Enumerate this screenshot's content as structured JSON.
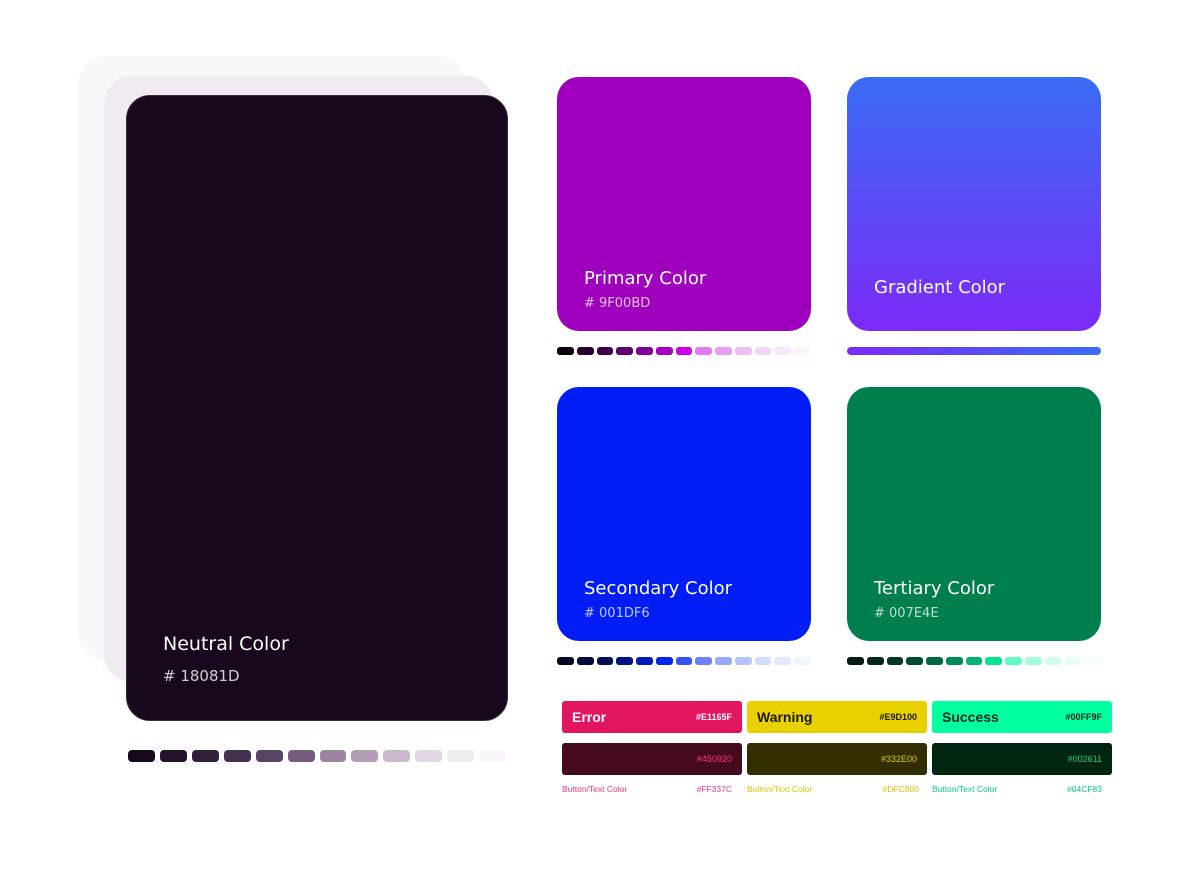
{
  "neutral": {
    "title": "Neutral Color",
    "hex": "# 18081D",
    "color": "#18081d",
    "swatches": [
      "#18081d",
      "#23122a",
      "#32203b",
      "#45304f",
      "#5a4466",
      "#775c80",
      "#9b849e",
      "#b29fb5",
      "#cbbacd",
      "#e1d6e3",
      "#f0eaf1",
      "#faf6fb"
    ]
  },
  "primary": {
    "title": "Primary Color",
    "hex": "# 9F00BD",
    "color": "#9f00bd",
    "swatches": [
      "#0f0014",
      "#28002f",
      "#3d0049",
      "#5e0070",
      "#80009a",
      "#a700c3",
      "#cb00e6",
      "#e27af2",
      "#ea9cf4",
      "#efbdf6",
      "#f4d6f8",
      "#f8e7fa",
      "#fcf3fd"
    ]
  },
  "gradient": {
    "title": "Gradient Color",
    "from": "#3a6cf4",
    "to": "#7b2af7"
  },
  "secondary": {
    "title": "Secondary Color",
    "hex": "# 001DF6",
    "color": "#001df6",
    "swatches": [
      "#00061f",
      "#000a3a",
      "#000e55",
      "#001385",
      "#001bb6",
      "#0028ea",
      "#3653f6",
      "#6b82f8",
      "#98a8fa",
      "#b6c4fb",
      "#d2dcfd",
      "#e3eafe",
      "#f1f5ff"
    ]
  },
  "tertiary": {
    "title": "Tertiary Color",
    "hex": "# 007E4E",
    "color": "#007e4e",
    "swatches": [
      "#001b11",
      "#00271a",
      "#003522",
      "#004a31",
      "#006645",
      "#008a5a",
      "#00b274",
      "#00e594",
      "#62fbc2",
      "#a4fcdb",
      "#cffde9",
      "#e8fef4",
      "#f4fffa"
    ]
  },
  "statuses": [
    {
      "key": "error",
      "label": "Error",
      "hex": "#E1165F",
      "color": "#e1165f",
      "text_color": "#ffffff",
      "dark_hex": "#450920",
      "dark_color": "#450920",
      "dark_text_color": "#ff337c",
      "caption": "Button/Text Color",
      "caption_hex": "#FF337C",
      "caption_color": "#ff337c"
    },
    {
      "key": "warning",
      "label": "Warning",
      "hex": "#E9D100",
      "color": "#e9d100",
      "text_color": "#1a1a00",
      "dark_hex": "#332E00",
      "dark_color": "#332e00",
      "dark_text_color": "#dfc800",
      "caption": "Button/Text Color",
      "caption_hex": "#DFC800",
      "caption_color": "#dfc800"
    },
    {
      "key": "success",
      "label": "Success",
      "hex": "#00FF9F",
      "color": "#00ff9f",
      "text_color": "#00271a",
      "dark_hex": "#002611",
      "dark_color": "#002611",
      "dark_text_color": "#04cf83",
      "caption": "Button/Text Color",
      "caption_hex": "#04CF83",
      "caption_color": "#04cf83"
    }
  ]
}
